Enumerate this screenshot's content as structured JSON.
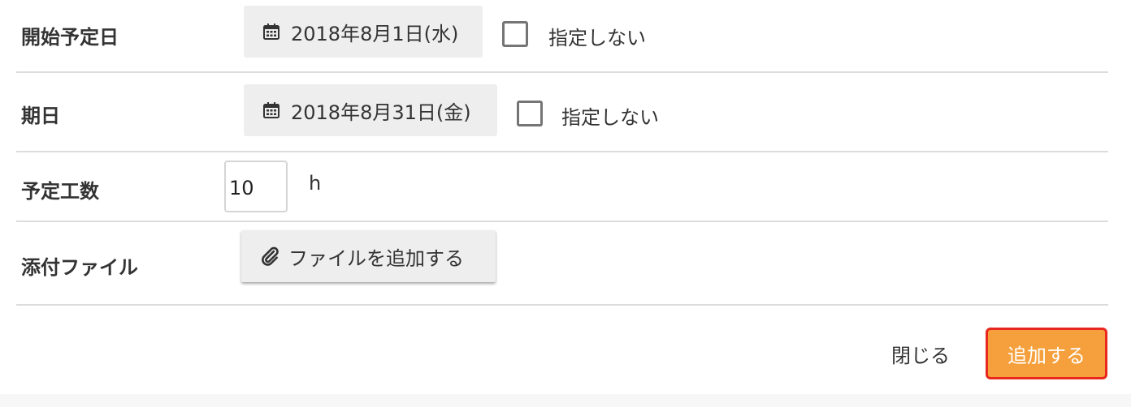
{
  "fields": {
    "start_date": {
      "label": "開始予定日",
      "value": "2018年8月1日(水)",
      "checkbox_label": "指定しない",
      "checked": false
    },
    "due_date": {
      "label": "期日",
      "value": "2018年8月31日(金)",
      "checkbox_label": "指定しない",
      "checked": false
    },
    "estimated_hours": {
      "label": "予定工数",
      "value": "10",
      "unit": "h"
    },
    "attachment": {
      "label": "添付ファイル",
      "button_label": "ファイルを追加する"
    }
  },
  "footer": {
    "close_label": "閉じる",
    "submit_label": "追加する"
  },
  "icons": {
    "date": "calendar-icon",
    "attach": "paperclip-icon"
  },
  "colors": {
    "submit_bg": "#f5a03c",
    "submit_border": "#e8281e",
    "button_gray": "#eeeeee",
    "divider": "#dcdcdc"
  }
}
